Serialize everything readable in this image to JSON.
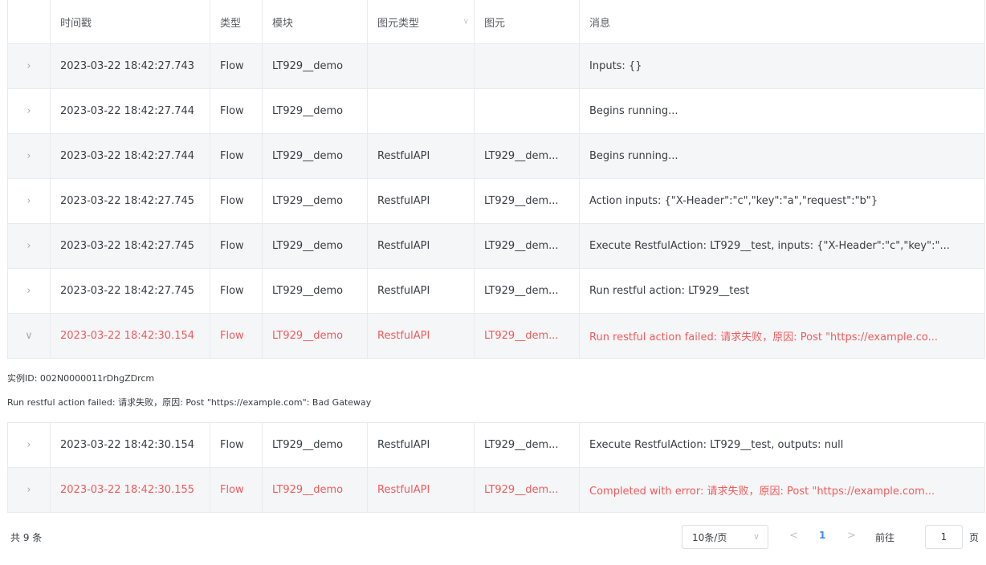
{
  "table": {
    "headers": {
      "expand": "",
      "timestamp": "时间戳",
      "type": "类型",
      "module": "模块",
      "element_type": "图元类型",
      "element": "图元",
      "message": "消息"
    },
    "rows": [
      {
        "timestamp": "2023-03-22 18:42:27.743",
        "type": "Flow",
        "module": "LT929__demo",
        "element_type": "",
        "element": "",
        "message": "Inputs: {}",
        "status": "normal",
        "expanded": false
      },
      {
        "timestamp": "2023-03-22 18:42:27.744",
        "type": "Flow",
        "module": "LT929__demo",
        "element_type": "",
        "element": "",
        "message": "Begins running...",
        "status": "normal",
        "expanded": false
      },
      {
        "timestamp": "2023-03-22 18:42:27.744",
        "type": "Flow",
        "module": "LT929__demo",
        "element_type": "RestfulAPI",
        "element": "LT929__dem...",
        "message": "Begins running...",
        "status": "normal",
        "expanded": false
      },
      {
        "timestamp": "2023-03-22 18:42:27.745",
        "type": "Flow",
        "module": "LT929__demo",
        "element_type": "RestfulAPI",
        "element": "LT929__dem...",
        "message": "Action inputs: {\"X-Header\":\"c\",\"key\":\"a\",\"request\":\"b\"}",
        "status": "normal",
        "expanded": false
      },
      {
        "timestamp": "2023-03-22 18:42:27.745",
        "type": "Flow",
        "module": "LT929__demo",
        "element_type": "RestfulAPI",
        "element": "LT929__dem...",
        "message": "Execute RestfulAction: LT929__test, inputs: {\"X-Header\":\"c\",\"key\":\"...",
        "status": "normal",
        "expanded": false
      },
      {
        "timestamp": "2023-03-22 18:42:27.745",
        "type": "Flow",
        "module": "LT929__demo",
        "element_type": "RestfulAPI",
        "element": "LT929__dem...",
        "message": "Run restful action: LT929__test",
        "status": "normal",
        "expanded": false
      },
      {
        "timestamp": "2023-03-22 18:42:30.154",
        "type": "Flow",
        "module": "LT929__demo",
        "element_type": "RestfulAPI",
        "element": "LT929__dem...",
        "message": "Run restful action failed: 请求失败，原因: Post \"https://example.co...",
        "status": "error",
        "expanded": true
      },
      {
        "timestamp": "2023-03-22 18:42:30.154",
        "type": "Flow",
        "module": "LT929__demo",
        "element_type": "RestfulAPI",
        "element": "LT929__dem...",
        "message": "Execute RestfulAction: LT929__test, outputs: null",
        "status": "normal",
        "expanded": false
      },
      {
        "timestamp": "2023-03-22 18:42:30.155",
        "type": "Flow",
        "module": "LT929__demo",
        "element_type": "RestfulAPI",
        "element": "LT929__dem...",
        "message": "Completed with error: 请求失败，原因: Post \"https://example.com...",
        "status": "error",
        "expanded": false
      }
    ],
    "expanded_detail": {
      "instance_id": "实例ID: 002N0000011rDhgZDrcm",
      "full_message": "Run restful action failed: 请求失败，原因: Post \"https://example.com\": Bad Gateway"
    }
  },
  "pagination": {
    "total": "共 9 条",
    "page_size": "10条/页",
    "current_page": "1",
    "goto_label": "前往",
    "goto_value": "1",
    "page_suffix": "页"
  },
  "icons": {
    "collapsed": "chevron-right-icon",
    "expanded": "chevron-down-icon"
  },
  "colors": {
    "error": "#f25b5b",
    "accent": "#3b8cff",
    "alt_row": "#f5f6f8",
    "border": "#e8eaee"
  }
}
